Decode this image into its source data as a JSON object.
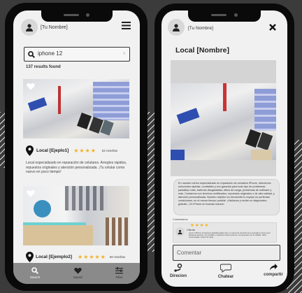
{
  "search_screen": {
    "user_name": "[Tu Nombre]",
    "search": {
      "value": "iphone 12"
    },
    "results_count": "137 results found",
    "listings": [
      {
        "name": "Local [Ejeplo1]",
        "stars": "★★★★",
        "rating": 4,
        "reviews": "62 reseñas",
        "description": "Local especializado en reparación de celulares. Arreglos rápidos, repuestos originales y atención personalizada. ¡Tu celular como nuevo en poco tiempo!",
        "saved": false
      },
      {
        "name": "Local [Ejemplo2]",
        "stars": "★★★★★",
        "rating": 5,
        "reviews": "50 reseñas",
        "saved": false
      }
    ],
    "nav": [
      {
        "label": "Search",
        "icon": "search-icon",
        "active": true
      },
      {
        "label": "Saved",
        "icon": "heart-icon"
      },
      {
        "label": "Filter",
        "icon": "filter-icon"
      }
    ]
  },
  "detail_screen": {
    "user_name": "[Tu Nombre]",
    "title": "Local [Nombre]",
    "description": "En nuestro centro especializado en reparación de celulares iPhone, ofrecemos soluciones rápidas, confiables y con garantía para todo tipo de problemas: pantallas rotas, baterías desgastadas, fallos de carga, problemas de software y más. Contamos con técnicos certificados, repuestos originales o de alta calidad, y atención personalizada. Nuestro objetivo es devolverte tu equipo en perfectas condiciones, en el menor tiempo posible. ¡Visítanos y recibe un diagnóstico gratuito. ¡Tu iPhone en buenas manos!",
    "comments_label": "Comentarios",
    "comment": {
      "stars": "★★★★",
      "rating": 4,
      "author": "Cliente",
      "text": "Llevé mi iPhone 12 porque la pantalla estaba rota y en menos de una hora me lo entregaron como nuevo. Excelente atención, muy amables y explicaron todo el proceso. Los repuestos son de calidad. 100% recomendado, volveré sin duda."
    },
    "comment_input": {
      "placeholder": "Comentar"
    },
    "actions": [
      {
        "label": "Direcion",
        "icon": "directions-icon"
      },
      {
        "label": "Chatear",
        "icon": "chat-icon"
      },
      {
        "label": "compartir",
        "icon": "share-icon"
      }
    ]
  },
  "colors": {
    "background": "#3b3b3b",
    "screen": "#f1f1f2",
    "nav": "#8a8a8a",
    "stars": "#f2b01e"
  }
}
